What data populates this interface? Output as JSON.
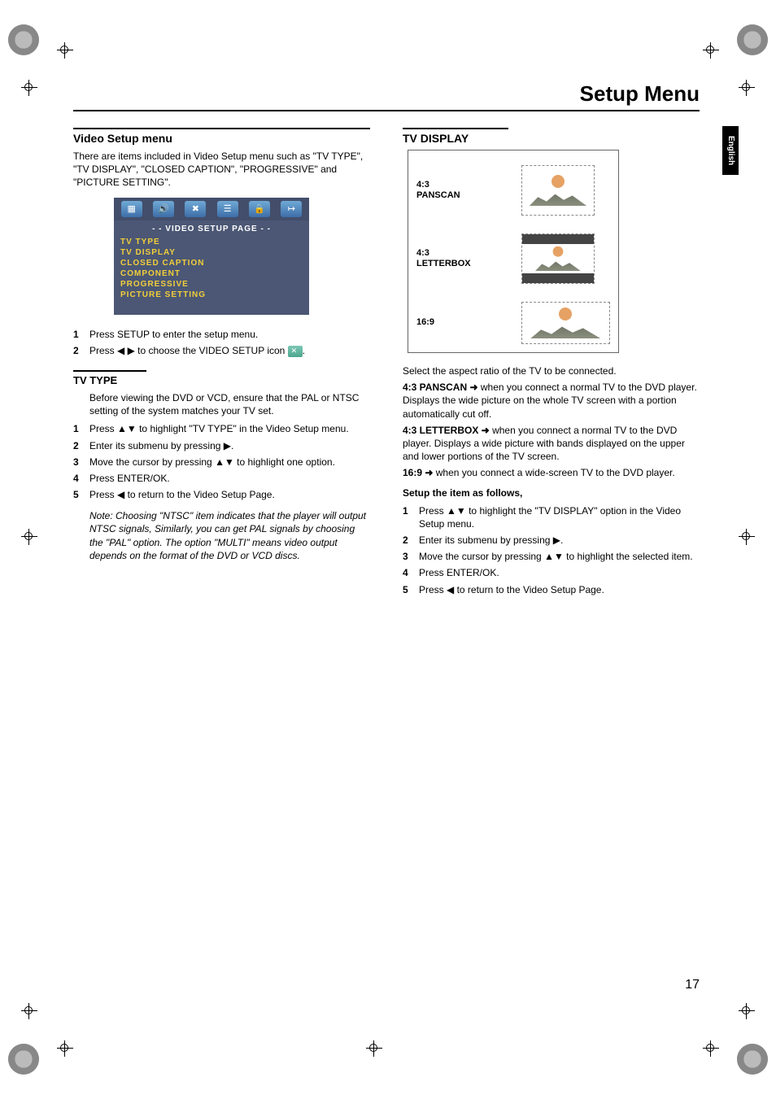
{
  "header": {
    "title": "Setup Menu"
  },
  "sidebar": {
    "lang": "English"
  },
  "left": {
    "heading": "Video Setup menu",
    "intro": "There are items included in Video Setup menu such as \"TV TYPE\", \"TV DISPLAY\", \"CLOSED CAPTION\", \"PROGRESSIVE\" and \"PICTURE SETTING\".",
    "menu": {
      "title": "- - VIDEO  SETUP  PAGE - -",
      "items": [
        "TV  TYPE",
        "TV  DISPLAY",
        "CLOSED  CAPTION",
        "COMPONENT",
        "PROGRESSIVE",
        "PICTURE  SETTING"
      ]
    },
    "stepsA": [
      "Press SETUP to enter the setup menu.",
      "Press ◀ ▶ to choose the VIDEO SETUP icon "
    ],
    "tvtype_heading": "TV TYPE",
    "tvtype_intro": "Before viewing the DVD or VCD, ensure that the PAL or NTSC setting of the system matches your TV set.",
    "stepsB": [
      "Press ▲▼ to highlight \"TV TYPE\" in the Video Setup menu.",
      "Enter its submenu by pressing ▶.",
      "Move the cursor by pressing ▲▼ to highlight one option.",
      "Press ENTER/OK.",
      "Press ◀ to return to the Video Setup Page."
    ],
    "note": "Note: Choosing \"NTSC\" item indicates that the player will output NTSC signals, Similarly, you can get PAL signals by choosing the \"PAL\" option. The option \"MULTI\" means video output depends on the format of the DVD or VCD discs."
  },
  "right": {
    "heading": "TV DISPLAY",
    "opts": [
      {
        "label": "4:3\nPANSCAN"
      },
      {
        "label": "4:3\nLETTERBOX"
      },
      {
        "label": "16:9"
      }
    ],
    "p_select": "Select the aspect ratio of the TV to be connected.",
    "panscan_b": "4:3 PANSCAN ➜",
    "panscan_t": " when you connect a normal TV to the DVD player. Displays the wide picture on the whole TV screen with a portion automatically cut off.",
    "letter_b": "4:3 LETTERBOX ➜",
    "letter_t": " when you connect a normal TV to the DVD player. Displays a wide picture with bands displayed on the upper and lower portions of the TV screen.",
    "wide_b": "16:9 ➜",
    "wide_t": " when you connect a wide-screen TV to the DVD player.",
    "setup_head": "Setup the item as follows,",
    "stepsC": [
      "Press ▲▼ to highlight the \"TV DISPLAY\" option in the Video Setup menu.",
      "Enter its submenu by pressing ▶.",
      "Move the cursor by pressing ▲▼ to highlight the selected item.",
      "Press ENTER/OK.",
      "Press ◀ to return to the Video Setup Page."
    ]
  },
  "page_number": "17"
}
